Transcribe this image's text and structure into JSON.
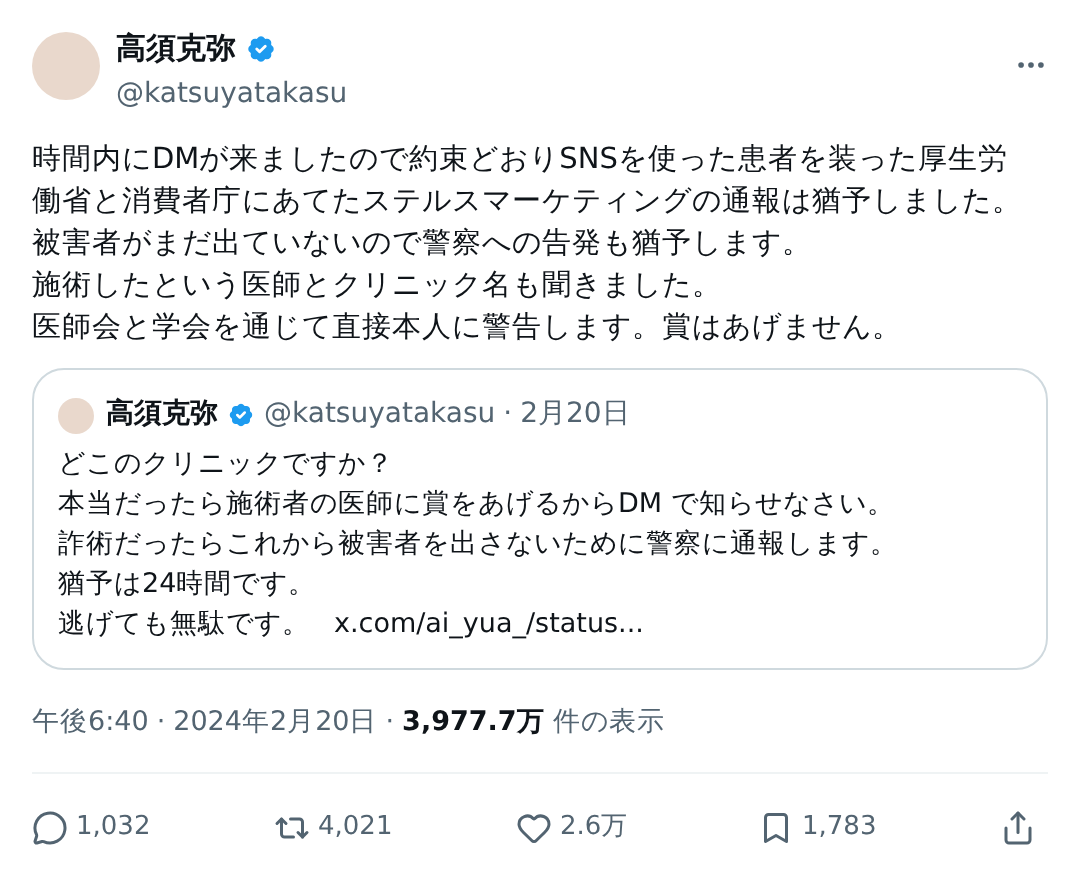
{
  "author": {
    "name": "高須克弥",
    "handle": "@katsuyatakasu",
    "verified": true
  },
  "body": [
    "時間内にDMが来ましたので約束どおりSNSを使った患者を装った厚生労働省と消費者庁にあてたステルスマーケティングの通報は猶予しました。",
    "被害者がまだ出ていないので警察への告発も猶予します。",
    "施術したという医師とクリニック名も聞きました。",
    "医師会と学会を通じて直接本人に警告します。賞はあげません。"
  ],
  "quote": {
    "name": "高須克弥",
    "verified": true,
    "handle": "@katsuyatakasu",
    "separator": "·",
    "date": "2月20日",
    "lines": [
      "どこのクリニックですか？",
      "本当だったら施術者の医師に賞をあげるからDM で知らせなさい。",
      "詐術だったらこれから被害者を出さないために警察に通報します。",
      "猶予は24時間です。",
      "逃げても無駄です。"
    ],
    "link": "x.com/ai_yua_/status..."
  },
  "meta": {
    "time": "午後6:40",
    "separator": "·",
    "date": "2024年2月20日",
    "views": "3,977.7万",
    "views_label": "件の表示"
  },
  "actions": [
    {
      "kind": "reply",
      "count": "1,032"
    },
    {
      "kind": "repost",
      "count": "4,021"
    },
    {
      "kind": "like",
      "count": "2.6万"
    },
    {
      "kind": "bookmark",
      "count": "1,783"
    },
    {
      "kind": "share"
    }
  ]
}
